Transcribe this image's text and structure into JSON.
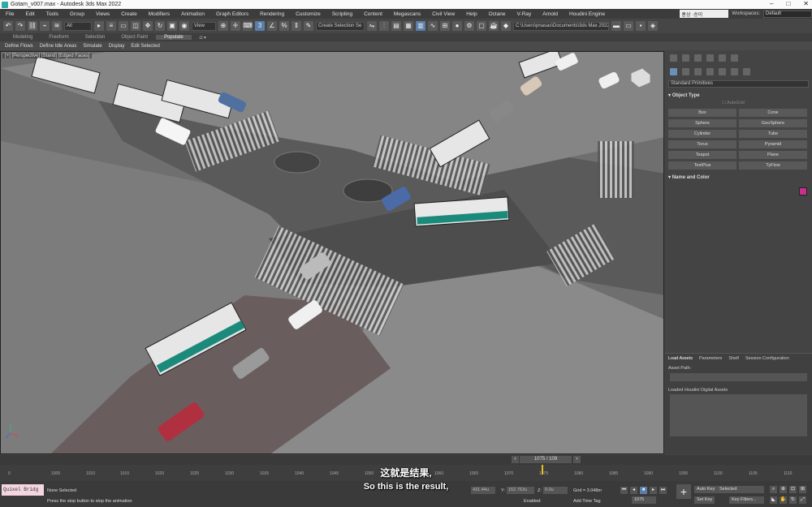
{
  "window": {
    "title": "Gotam_v007.max - Autodesk 3ds Max 2022"
  },
  "menu": [
    "File",
    "Edit",
    "Tools",
    "Group",
    "Views",
    "Create",
    "Modifiers",
    "Animation",
    "Graph Editors",
    "Rendering",
    "Customize",
    "Scripting",
    "Content",
    "Megascans",
    "Civil View",
    "Help",
    "Octane",
    "V-Ray",
    "Arnold",
    "Houdini Engine"
  ],
  "lang": "홍상 ·승이",
  "workspaces": {
    "label": "Workspaces:",
    "value": "Default"
  },
  "toolbar": {
    "filter": "All",
    "view": "View",
    "selection_set": "Create Selection Se",
    "project_path": "C:\\Users\\pnasas\\Documents\\3ds Max 2022"
  },
  "ribbon": {
    "tabs": [
      "Modeling",
      "Freeform",
      "Selection",
      "Object Paint",
      "Populate"
    ],
    "active": "Populate"
  },
  "subribbon": [
    "Define Flows",
    "Define Idle Areas",
    "Simulate",
    "Display",
    "Edit Selected"
  ],
  "viewport": {
    "label": "[+] [Perspective] [Stand] [Edged Faces]"
  },
  "cmd": {
    "category": "Standard Primitives",
    "object_type_title": "Object Type",
    "autogrid": "AutoGrid",
    "buttons": [
      "Box",
      "Cone",
      "Sphere",
      "GeoSphere",
      "Cylinder",
      "Tube",
      "Torus",
      "Pyramid",
      "Teapot",
      "Plane",
      "TextPlus",
      "TyFlow"
    ],
    "name_color_title": "Name and Color",
    "name_color_hex": "#c8308c",
    "lower_tabs": [
      "Load Assets",
      "Parameters",
      "Shelf",
      "Session Configuration"
    ],
    "asset_path": "Asset Path:",
    "loaded_assets": "Loaded Houdini Digital Assets"
  },
  "timeline": {
    "frame": "1075 / 109",
    "ticks": [
      "0",
      "1005",
      "1010",
      "1015",
      "1020",
      "1025",
      "1030",
      "1035",
      "1040",
      "1045",
      "1050",
      "1055",
      "1060",
      "1065",
      "1070",
      "1075",
      "1080",
      "1085",
      "1090",
      "1095",
      "1100",
      "1105",
      "1110"
    ]
  },
  "status": {
    "quixel": "Quixel Bridg",
    "none_selected": "None Selected",
    "hint": "Press the stop button to stop the animation",
    "x": "431.44u",
    "y": "152.763u",
    "z": "0.0u",
    "grid": "Grid = 3.048m",
    "enabled": "Enabled:",
    "add_time_tag": "Add Time Tag",
    "frame_field": "1075",
    "auto_key": "Auto Key",
    "selected": "Selected",
    "set_key": "Set Key",
    "key_filters": "Key Filters..."
  },
  "subtitles": {
    "zh": "这就是结果,",
    "en": "So this is the result,"
  }
}
